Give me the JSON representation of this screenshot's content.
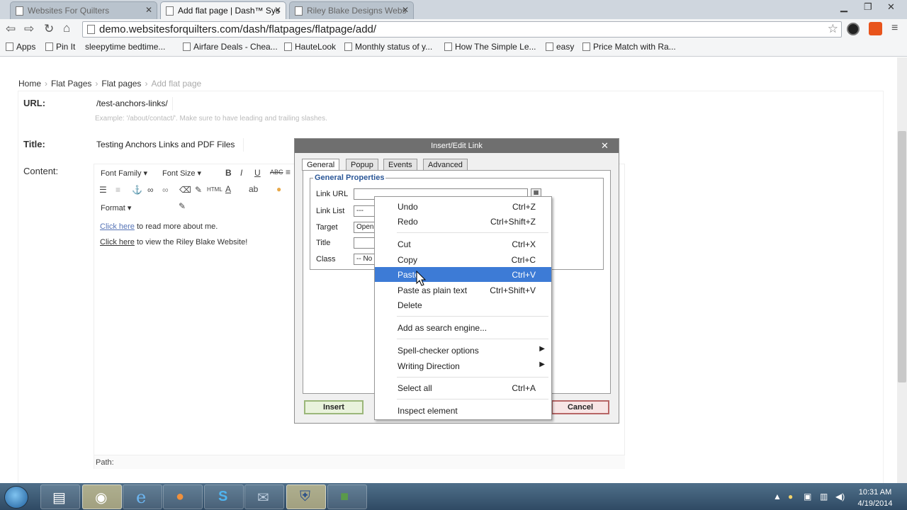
{
  "browser": {
    "tabs": [
      {
        "label": "Websites For Quilters",
        "active": false
      },
      {
        "label": "Add flat page | Dash™ Sys",
        "active": true
      },
      {
        "label": "Riley Blake Designs Webs",
        "active": false
      }
    ],
    "url": "demo.websitesforquilters.com/dash/flatpages/flatpage/add/",
    "bookmarks": [
      "Apps",
      "Pin It",
      "sleepytime bedtime...",
      "Airfare Deals - Chea...",
      "HauteLook",
      "Monthly status of y...",
      "How The Simple Le...",
      "easy",
      "Price Match with Ra..."
    ]
  },
  "breadcrumb": {
    "items": [
      "Home",
      "Flat Pages",
      "Flat pages"
    ],
    "current": "Add flat page"
  },
  "form": {
    "url_label": "URL:",
    "url_value": "/test-anchors-links/",
    "url_help": "Example: '/about/contact/'. Make sure to have leading and trailing slashes.",
    "title_label": "Title:",
    "title_value": "Testing Anchors Links and PDF Files",
    "content_label": "Content:"
  },
  "editor": {
    "font_family": "Font Family",
    "font_size": "Font Size",
    "format": "Format",
    "line1_link": "Click here",
    "line1_rest": " to read more about me.",
    "line2_link": "Click here",
    "line2_rest": " to view the Riley Blake Website!",
    "path": "Path:"
  },
  "dialog": {
    "title": "Insert/Edit Link",
    "tabs": [
      "General",
      "Popup",
      "Events",
      "Advanced"
    ],
    "legend": "General Properties",
    "labels": [
      "Link URL",
      "Link List",
      "Target",
      "Title",
      "Class"
    ],
    "values": {
      "link_list": "---",
      "target": "Open",
      "class": "-- No"
    },
    "insert": "Insert",
    "cancel": "Cancel"
  },
  "context_menu": {
    "items": [
      {
        "label": "Undo",
        "shortcut": "Ctrl+Z"
      },
      {
        "label": "Redo",
        "shortcut": "Ctrl+Shift+Z"
      },
      {
        "label": "Cut",
        "shortcut": "Ctrl+X"
      },
      {
        "label": "Copy",
        "shortcut": "Ctrl+C"
      },
      {
        "label": "Paste",
        "shortcut": "Ctrl+V",
        "highlighted": true
      },
      {
        "label": "Paste as plain text",
        "shortcut": "Ctrl+Shift+V"
      },
      {
        "label": "Delete",
        "shortcut": ""
      },
      {
        "label": "Add as search engine...",
        "shortcut": ""
      },
      {
        "label": "Spell-checker options",
        "shortcut": "",
        "submenu": true
      },
      {
        "label": "Writing Direction",
        "shortcut": "",
        "submenu": true
      },
      {
        "label": "Select all",
        "shortcut": "Ctrl+A"
      },
      {
        "label": "Inspect element",
        "shortcut": ""
      }
    ]
  },
  "taskbar": {
    "time": "10:31 AM",
    "date": "4/19/2014"
  },
  "colors": {
    "highlight": "#3d7bd6",
    "legend": "#2b5797",
    "taskbar": "#2f4a64"
  }
}
